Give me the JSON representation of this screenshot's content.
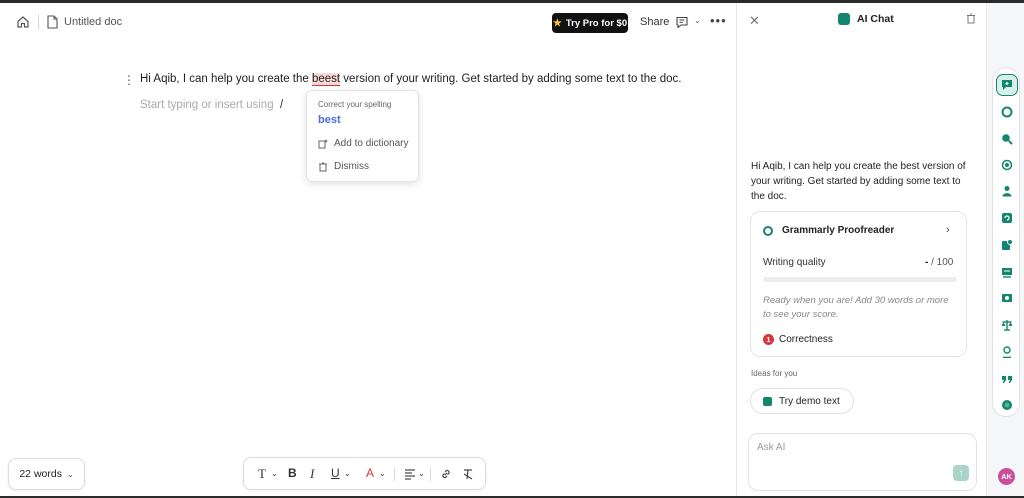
{
  "header": {
    "doc_title": "Untitled doc",
    "pro_button": "Try Pro for $0",
    "share": "Share"
  },
  "editor": {
    "para_before": "Hi Aqib, I can help you create the ",
    "misspelled_word": "beest",
    "para_after": " version of your writing. Get started by adding some text to the doc.",
    "placeholder": "Start typing or insert using",
    "slash": "/"
  },
  "spell_popup": {
    "hint": "Correct your spelling",
    "suggestion": "best",
    "add_to_dictionary": "Add to dictionary",
    "dismiss": "Dismiss"
  },
  "word_count": {
    "label": "22 words"
  },
  "format_toolbar": {
    "text_style": "T",
    "bold": "B",
    "italic": "I",
    "underline": "U",
    "font_color": "A"
  },
  "chat": {
    "title": "AI Chat",
    "intro": "Hi Aqib, I can help you create the best version of your writing. Get started by adding some text to the doc.",
    "proofreader": {
      "title": "Grammarly Proofreader",
      "writing_quality_label": "Writing quality",
      "score_value": "-",
      "score_max": "/ 100",
      "score_fraction": 0,
      "ready_text": "Ready when you are! Add 30 words or more to see your score.",
      "correctness_count": "1",
      "correctness_label": "Correctness"
    },
    "ideas_label": "Ideas for you",
    "demo_button": "Try demo text",
    "ask_placeholder": "Ask AI"
  },
  "rail": {
    "icons": [
      "ai-chat-icon",
      "proofreader-icon",
      "ai-detector-icon",
      "plagiarism-icon",
      "humanizer-icon",
      "paraphraser-icon",
      "reader-reactions-icon",
      "grader-icon",
      "citation-icon",
      "expert-review-icon",
      "quote-icon",
      "more-icon"
    ],
    "avatar": "AK"
  },
  "colors": {
    "accent": "#14866d",
    "error": "#d9343a",
    "suggestion": "#4a6ee0"
  }
}
